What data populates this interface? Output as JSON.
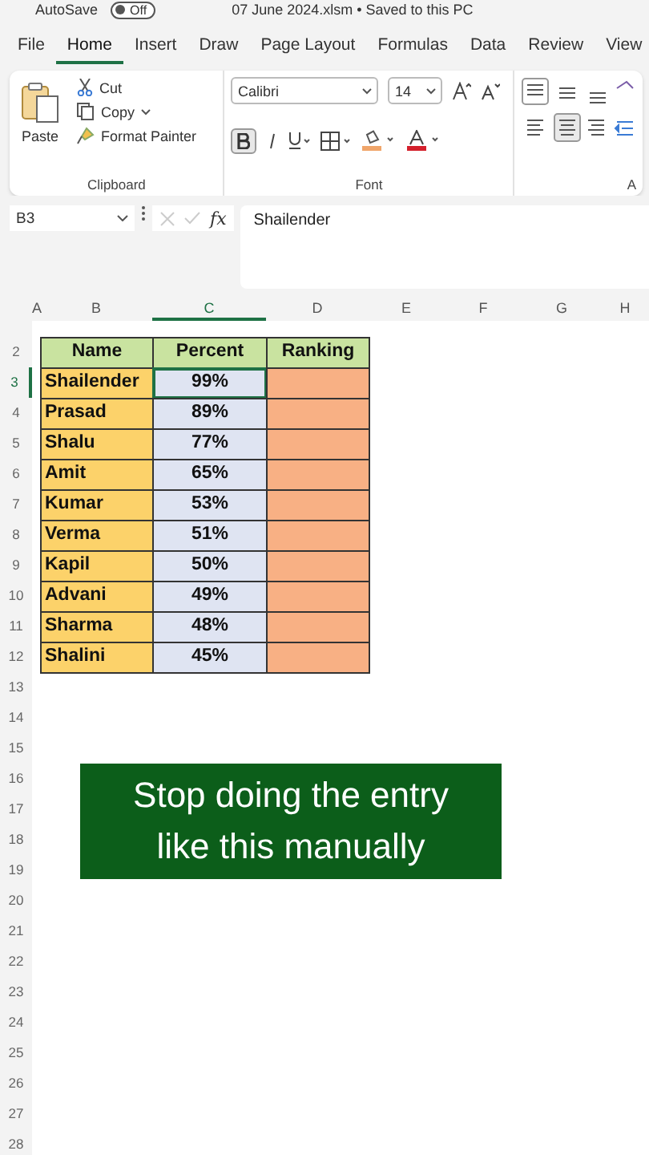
{
  "title_bar": {
    "autosave_label": "AutoSave",
    "autosave_toggle": {
      "label": "Off",
      "on": false
    },
    "file_title": "07 June 2024.xlsm • Saved to this PC"
  },
  "tabs": [
    {
      "label": "File",
      "selected": false
    },
    {
      "label": "Home",
      "selected": true
    },
    {
      "label": "Insert",
      "selected": false
    },
    {
      "label": "Draw",
      "selected": false
    },
    {
      "label": "Page Layout",
      "selected": false
    },
    {
      "label": "Formulas",
      "selected": false
    },
    {
      "label": "Data",
      "selected": false
    },
    {
      "label": "Review",
      "selected": false
    },
    {
      "label": "View",
      "selected": false
    }
  ],
  "ribbon": {
    "clipboard": {
      "paste": "Paste",
      "cut": "Cut",
      "copy": "Copy",
      "format_painter": "Format Painter",
      "label": "Clipboard"
    },
    "font": {
      "font_name": "Calibri",
      "font_size": "14",
      "bold_on": true,
      "label": "Font"
    },
    "alignment": {
      "label": "A"
    }
  },
  "formula_bar": {
    "name_box": "B3",
    "fx": "fx",
    "content": "Shailender"
  },
  "columns": [
    {
      "label": "A",
      "selected": false
    },
    {
      "label": "B",
      "selected": false
    },
    {
      "label": "C",
      "selected": true
    },
    {
      "label": "D",
      "selected": false
    },
    {
      "label": "E",
      "selected": false
    },
    {
      "label": "F",
      "selected": false
    },
    {
      "label": "G",
      "selected": false
    },
    {
      "label": "H",
      "selected": false
    }
  ],
  "table": {
    "headers": [
      "Name",
      "Percent",
      "Ranking"
    ],
    "rows": [
      {
        "row": "3",
        "name": "Shailender",
        "percent": "99%",
        "selected": true
      },
      {
        "row": "4",
        "name": "Prasad",
        "percent": "89%",
        "selected": false
      },
      {
        "row": "5",
        "name": "Shalu",
        "percent": "77%",
        "selected": false
      },
      {
        "row": "6",
        "name": "Amit",
        "percent": "65%",
        "selected": false
      },
      {
        "row": "7",
        "name": "Kumar",
        "percent": "53%",
        "selected": false
      },
      {
        "row": "8",
        "name": "Verma",
        "percent": "51%",
        "selected": false
      },
      {
        "row": "9",
        "name": "Kapil",
        "percent": "50%",
        "selected": false
      },
      {
        "row": "10",
        "name": "Advani",
        "percent": "49%",
        "selected": false
      },
      {
        "row": "11",
        "name": "Sharma",
        "percent": "48%",
        "selected": false
      },
      {
        "row": "12",
        "name": "Shalini",
        "percent": "45%",
        "selected": false
      }
    ],
    "header_row": "2"
  },
  "empty_rows": [
    "13",
    "14",
    "15",
    "16",
    "17",
    "18",
    "19",
    "20",
    "21",
    "22",
    "23",
    "24",
    "25",
    "26",
    "27",
    "28"
  ],
  "banner": {
    "lines": [
      "Stop doing the entry",
      "like this manually"
    ]
  }
}
